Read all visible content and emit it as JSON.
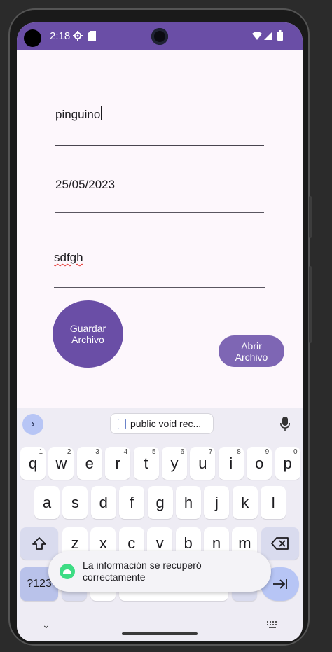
{
  "status_bar": {
    "time": "2:18"
  },
  "fields": {
    "name": "pinguino",
    "date": "25/05/2023",
    "content": "sdfgh"
  },
  "buttons": {
    "save": [
      "Guardar",
      "Archivo"
    ],
    "open": [
      "Abrir",
      "Archivo"
    ]
  },
  "keyboard": {
    "suggestion": "public void rec...",
    "row1": [
      {
        "k": "q",
        "h": "1"
      },
      {
        "k": "w",
        "h": "2"
      },
      {
        "k": "e",
        "h": "3"
      },
      {
        "k": "r",
        "h": "4"
      },
      {
        "k": "t",
        "h": "5"
      },
      {
        "k": "y",
        "h": "6"
      },
      {
        "k": "u",
        "h": "7"
      },
      {
        "k": "i",
        "h": "8"
      },
      {
        "k": "o",
        "h": "9"
      },
      {
        "k": "p",
        "h": "0"
      }
    ],
    "row2": [
      "a",
      "s",
      "d",
      "f",
      "g",
      "h",
      "j",
      "k",
      "l"
    ],
    "row3": [
      "z",
      "x",
      "c",
      "v",
      "b",
      "n",
      "m"
    ],
    "symbols_label": "?123"
  },
  "toast": {
    "line1": "La información se recuperó",
    "line2": "correctamente"
  },
  "colors": {
    "status_bar": "#6a4ea6",
    "primary_button": "#6a4ea6",
    "secondary_button": "#7e66b4",
    "keyboard_accent": "#b7c5f5"
  }
}
